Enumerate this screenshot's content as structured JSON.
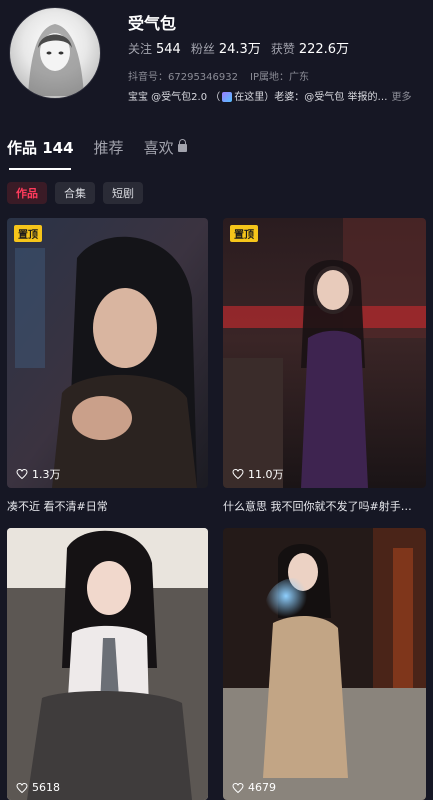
{
  "profile": {
    "name": "受气包",
    "following_label": "关注",
    "following_count": "544",
    "followers_label": "粉丝",
    "followers_count": "24.3万",
    "likes_label": "获赞",
    "likes_count": "222.6万",
    "douyin_id": "抖音号：67295346932",
    "ip_location": "IP属地：广东",
    "bio_part1": "宝宝 @受气包2.0 （",
    "bio_part2": "在这里）老婆：@受气包 举报的…",
    "bio_more": "更多"
  },
  "tabs": [
    {
      "label": "作品 144"
    },
    {
      "label": "推荐"
    },
    {
      "label": "喜欢"
    }
  ],
  "chips": [
    {
      "label": "作品"
    },
    {
      "label": "合集"
    },
    {
      "label": "短剧"
    }
  ],
  "videos": [
    {
      "pinned": "置顶",
      "likes": "1.3万",
      "caption": "凑不近 看不清#日常"
    },
    {
      "pinned": "置顶",
      "likes": "11.0万",
      "caption": "什么意思 我不回你就不发了吗#射手…"
    },
    {
      "likes": "5618"
    },
    {
      "likes": "4679"
    }
  ],
  "colors": {
    "background": "#161724",
    "accent": "#ff3b5c",
    "pin_badge": "#f6c51a"
  }
}
